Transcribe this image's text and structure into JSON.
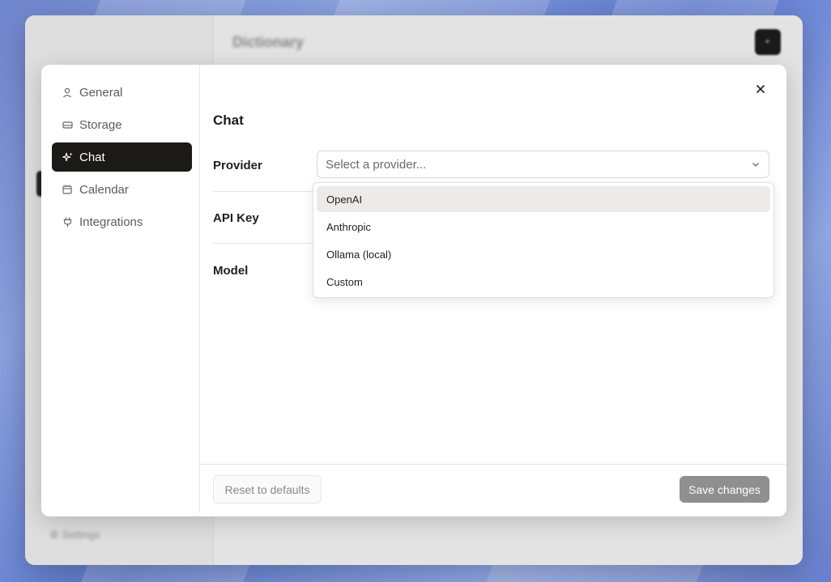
{
  "background_window": {
    "title": "Dictionary",
    "footer_label": "Settings"
  },
  "settings_nav": {
    "items": [
      {
        "label": "General",
        "icon": "user-icon",
        "active": false
      },
      {
        "label": "Storage",
        "icon": "drive-icon",
        "active": false
      },
      {
        "label": "Chat",
        "icon": "sparkles-icon",
        "active": true
      },
      {
        "label": "Calendar",
        "icon": "calendar-icon",
        "active": false
      },
      {
        "label": "Integrations",
        "icon": "plug-icon",
        "active": false
      }
    ]
  },
  "chat_settings": {
    "section_title": "Chat",
    "provider_label": "Provider",
    "provider_placeholder": "Select a provider...",
    "api_key_label": "API Key",
    "model_label": "Model",
    "provider_options": [
      "OpenAI",
      "Anthropic",
      "Ollama (local)",
      "Custom"
    ],
    "highlighted_option": "OpenAI"
  },
  "footer": {
    "reset_label": "Reset to defaults",
    "save_label": "Save changes"
  },
  "colors": {
    "active_nav_bg": "#1c1a17",
    "save_button_bg": "#8f8f8f",
    "highlight_option_bg": "#ecebe8"
  }
}
